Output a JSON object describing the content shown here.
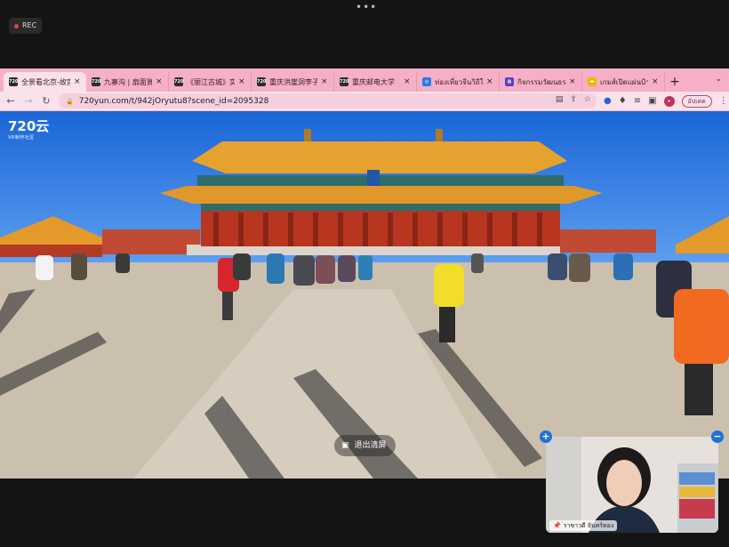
{
  "recording": {
    "label": "REC",
    "more_glyph": "•••"
  },
  "tabs": [
    {
      "favicon": "720",
      "favicon_color": "#2c2c2c",
      "title": "全景看北京-故宫",
      "active": true
    },
    {
      "favicon": "720",
      "favicon_color": "#2c2c2c",
      "title": "九寨沟 | 扇面賞红",
      "active": false
    },
    {
      "favicon": "720",
      "favicon_color": "#2c2c2c",
      "title": "《丽江古城》实景",
      "active": false
    },
    {
      "favicon": "720",
      "favicon_color": "#2c2c2c",
      "title": "重庆洪崖洞李子坝",
      "active": false
    },
    {
      "favicon": "720",
      "favicon_color": "#2c2c2c",
      "title": "重庆邮电大学",
      "active": false
    },
    {
      "favicon": "◎",
      "favicon_color": "#2a7be4",
      "title": "ท่องเที่ยวจีนวิถีใหม่",
      "active": false
    },
    {
      "favicon": "▦",
      "favicon_color": "#5b3fc4",
      "title": "กิจกรรมวัฒนธรรม",
      "active": false
    },
    {
      "favicon": "▬",
      "favicon_color": "#f2b600",
      "title": "เกมส์เปิดแผ่นป้ายทาย",
      "active": false
    }
  ],
  "tabstrip": {
    "new_tab_glyph": "+",
    "menu_glyph": "⌄"
  },
  "toolbar": {
    "back_glyph": "←",
    "forward_glyph": "→",
    "reload_glyph": "↻",
    "url": "720yun.com/t/942jOryutu8?scene_id=2095328",
    "update_label": "อัปเดต",
    "avatar_initial": "•"
  },
  "pano": {
    "logo": "720云",
    "logo_sub": "VR制作社区",
    "exit_label": "退出清屏"
  },
  "video": {
    "participant_name": "ราชาวดี จันทร์ทอง",
    "zoom_in_glyph": "+",
    "zoom_out_glyph": "−"
  }
}
